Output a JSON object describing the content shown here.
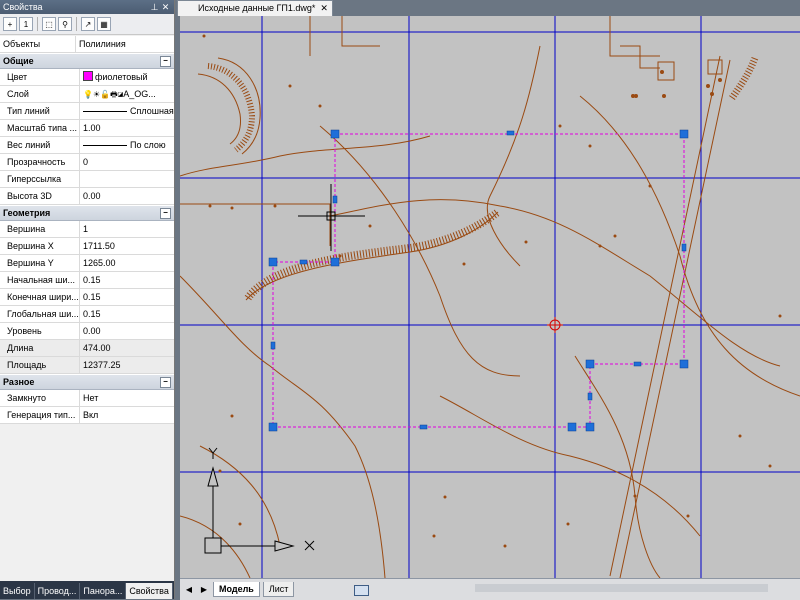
{
  "palette": {
    "panel_bg": "#f0f0f0",
    "drawing_bg": "#c2c2c2",
    "grid_blue": "#0000c8",
    "entity_brown": "#9a4a12",
    "selection_magenta": "#e000e0",
    "grip_blue": "#1e6fd9"
  },
  "panel": {
    "title": "Свойства",
    "pin_icon": "pin-icon",
    "close_icon": "close-icon",
    "objects_label": "Объекты",
    "objects_value": "Полилиния",
    "toolbar_icons": [
      "quick-select-icon",
      "select-objects-icon",
      "toggle-pickadd-icon",
      "export-icon",
      "settings-icon"
    ],
    "toolbar_first_label": "1",
    "categories": [
      {
        "name": "Общие",
        "rows": [
          {
            "label": "Цвет",
            "value": "фиолетовый",
            "swatch": "#ff00ff"
          },
          {
            "label": "Слой",
            "value": "A_OG..."
          },
          {
            "label": "Тип линий",
            "value": "Сплошная",
            "linesample": true
          },
          {
            "label": "Масштаб типа ...",
            "value": "1.00"
          },
          {
            "label": "Вес линий",
            "value": "По слою",
            "linesample": true
          },
          {
            "label": "Прозрачность",
            "value": "0"
          },
          {
            "label": "Гиперссылка",
            "value": ""
          },
          {
            "label": "Высота 3D",
            "value": "0.00"
          }
        ]
      },
      {
        "name": "Геометрия",
        "rows": [
          {
            "label": "Вершина",
            "value": "1"
          },
          {
            "label": "Вершина X",
            "value": "1711.50"
          },
          {
            "label": "Вершина Y",
            "value": "1265.00"
          },
          {
            "label": "Начальная ши...",
            "value": "0.15"
          },
          {
            "label": "Конечная шири...",
            "value": "0.15"
          },
          {
            "label": "Глобальная ши...",
            "value": "0.15"
          },
          {
            "label": "Уровень",
            "value": "0.00"
          },
          {
            "label": "Длина",
            "value": "474.00",
            "readonly": true
          },
          {
            "label": "Площадь",
            "value": "12377.25",
            "readonly": true
          }
        ]
      },
      {
        "name": "Разное",
        "rows": [
          {
            "label": "Замкнуто",
            "value": "Нет"
          },
          {
            "label": "Генерация тип...",
            "value": "Вкл"
          }
        ]
      }
    ],
    "tabs": [
      "Выбор",
      "Провод...",
      "Панора...",
      "Свойства"
    ]
  },
  "document": {
    "tab": "Исходные данные ГП1.dwg*",
    "close_icon": "close-icon"
  },
  "layout_tabs": [
    "Модель",
    "Лист"
  ],
  "ucs": {
    "y_label": "Y",
    "x_label": "X"
  }
}
